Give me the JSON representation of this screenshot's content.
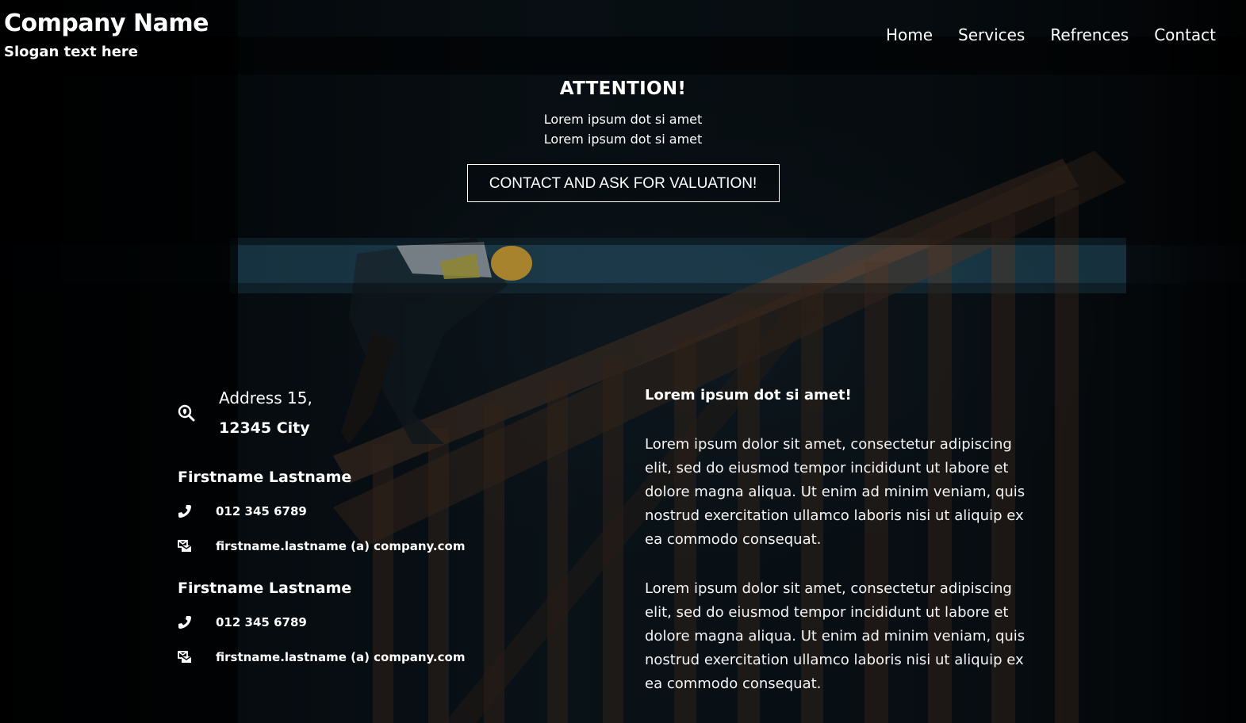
{
  "header": {
    "company_name": "Company Name",
    "slogan": "Slogan text here",
    "nav": [
      {
        "label": "Home"
      },
      {
        "label": "Services"
      },
      {
        "label": "Refrences"
      },
      {
        "label": "Contact"
      }
    ]
  },
  "hero": {
    "title": "ATTENTION!",
    "lines": [
      "Lorem ipsum dot si amet",
      "Lorem ipsum dot si amet"
    ],
    "cta_label": "CONTACT AND ASK FOR VALUATION!"
  },
  "contact": {
    "address_icon": "search-location-icon",
    "address_line1": "Address 15,",
    "address_line2": "12345 City",
    "people": [
      {
        "name": "Firstname Lastname",
        "phone_icon": "phone-icon",
        "phone": "012 345 6789",
        "email_icon": "mail-icon",
        "email": "firstname.lastname (a) company.com"
      },
      {
        "name": "Firstname Lastname",
        "phone_icon": "phone-icon",
        "phone": "012 345 6789",
        "email_icon": "mail-icon",
        "email": "firstname.lastname (a) company.com"
      }
    ]
  },
  "content": {
    "heading": "Lorem ipsum dot si amet!",
    "paragraphs": [
      "Lorem ipsum dolor sit amet, consectetur adipiscing elit, sed do eiusmod tempor incididunt ut labore et dolore magna aliqua. Ut enim ad minim veniam, quis nostrud exercitation ullamco laboris nisi ut aliquip ex ea commodo consequat.",
      "Lorem ipsum dolor sit amet, consectetur adipiscing elit, sed do eiusmod tempor incididunt ut labore et dolore magna aliqua. Ut enim ad minim veniam, quis nostrud exercitation ullamco laboris nisi ut aliquip ex ea commodo consequat."
    ]
  },
  "colors": {
    "text": "#ffffff",
    "background": "#05080b",
    "helmet": "#f0b030",
    "timber": "#6b4a35"
  }
}
